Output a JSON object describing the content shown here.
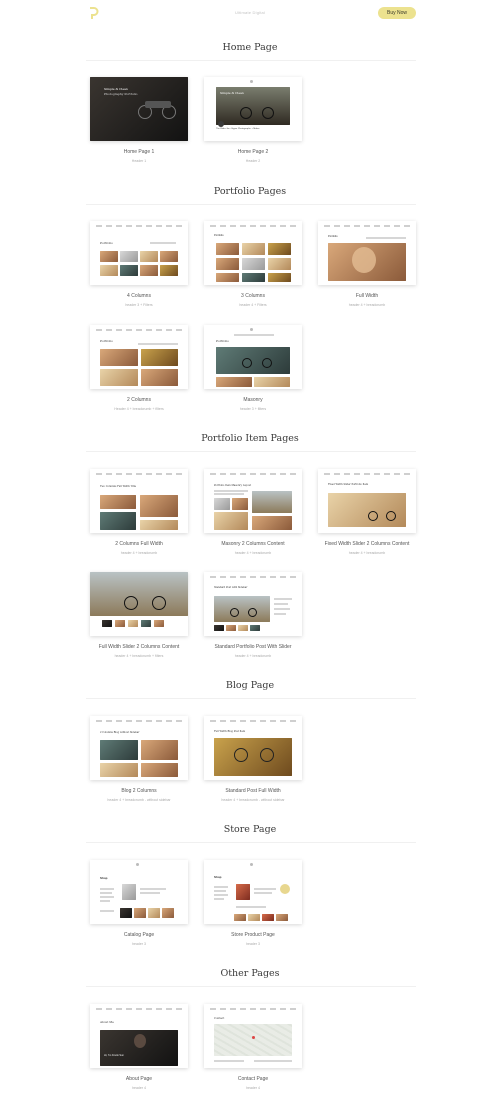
{
  "header": {
    "tagline": "Ultimate Digital",
    "buy_label": "Buy Now",
    "accent": "#ece28f"
  },
  "sections": {
    "home": {
      "title": "Home Page",
      "cards": [
        {
          "title": "Home Page 1",
          "sub": "Header 1"
        },
        {
          "title": "Home Page 2",
          "sub": "Header 2"
        }
      ]
    },
    "portfolio": {
      "title": "Portfolio Pages",
      "cards": [
        {
          "title": "4 Columns",
          "sub": "header 3 + Filters"
        },
        {
          "title": "3 Columns",
          "sub": "header 4 + Filters"
        },
        {
          "title": "Full Width",
          "sub": "header 4 + breadcrumb"
        },
        {
          "title": "2 Columns",
          "sub": "Header 4 + breadcrumb + filters"
        },
        {
          "title": "Masonry",
          "sub": "header 3 + filters"
        }
      ]
    },
    "item": {
      "title": "Portfolio Item Pages",
      "cards": [
        {
          "title": "2 Columns Full Width",
          "sub": "header 4 + breadcrumb"
        },
        {
          "title": "Masonry 2 Columns Content",
          "sub": "header 4 + breadcrumb"
        },
        {
          "title": "Fixed Width Slider 2 Columns Content",
          "sub": "header 4 + breadcrumb"
        },
        {
          "title": "Full Width Slider 2 Columns Content",
          "sub": "header 4 + breadcrumb + filters"
        },
        {
          "title": "Standard Portfolio Post With Slider",
          "sub": "header 4 + breadcrumb"
        }
      ]
    },
    "blog": {
      "title": "Blog Page",
      "cards": [
        {
          "title": "Blog 2 Columns",
          "sub": "header 4 + breadcrumb - without sidebar"
        },
        {
          "title": "Standard Post Full Width",
          "sub": "header 4 + breadcrumb - without sidebar"
        }
      ]
    },
    "store": {
      "title": "Store Page",
      "cards": [
        {
          "title": "Catalog Page",
          "sub": "header 3"
        },
        {
          "title": "Store Product Page",
          "sub": "header 3"
        }
      ]
    },
    "other": {
      "title": "Other Pages",
      "cards": [
        {
          "title": "About Page",
          "sub": "header 4"
        },
        {
          "title": "Contact Page",
          "sub": "header 4"
        }
      ]
    }
  },
  "thumb_text": {
    "home1_heading": "Simple & Clean",
    "home1_sub": "Photography Portfolio",
    "home2_heading": "Simple & Clean",
    "home2_caption": "The Rider Jim - Hyper Photographic + Maker",
    "portfolio_label": "Portfolio",
    "item1_heading": "Two Columns Full Width Title",
    "item2_heading": "Portfolio Item Masonry Layout",
    "item3_heading": "Fixed Width Slider Portfolio Item",
    "item5_heading": "Standard Post with Sidebar",
    "blog1_heading": "2 Columns Blog without Sidebar",
    "blog2_heading": "Full Width Blog Post Item",
    "shop_label": "Shop",
    "about_label": "About Me",
    "about_overlay": "Hi, I'm Frank Sun",
    "contact_label": "Contact"
  }
}
